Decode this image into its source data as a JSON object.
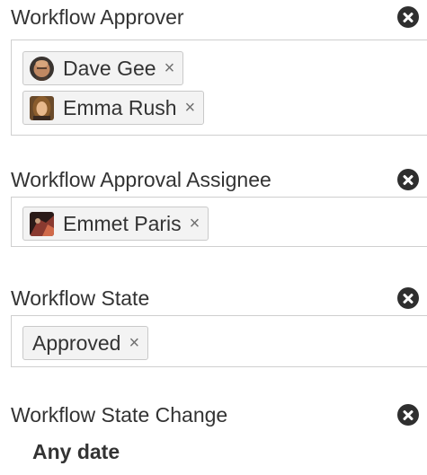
{
  "filters": [
    {
      "title": "Workflow Approver",
      "tokens": [
        {
          "label": "Dave Gee",
          "remove": "×",
          "avatar": "dave-gee-avatar"
        },
        {
          "label": "Emma Rush",
          "remove": "×",
          "avatar": "emma-rush-avatar"
        }
      ]
    },
    {
      "title": "Workflow Approval Assignee",
      "tokens": [
        {
          "label": "Emmet Paris",
          "remove": "×",
          "avatar": "emmet-paris-avatar"
        }
      ]
    },
    {
      "title": "Workflow State",
      "tokens": [
        {
          "label": "Approved",
          "remove": "×"
        }
      ]
    },
    {
      "title": "Workflow State Change",
      "value": "Any date"
    }
  ],
  "icons": {
    "remove_filter": "close-circle-icon",
    "remove_token": "x-icon"
  },
  "colors": {
    "token_bg": "#f3f3f3",
    "token_border": "#c9c9c9",
    "box_border": "#cfcfcf",
    "text": "#333333",
    "remove_button": "#2f2f2f"
  }
}
